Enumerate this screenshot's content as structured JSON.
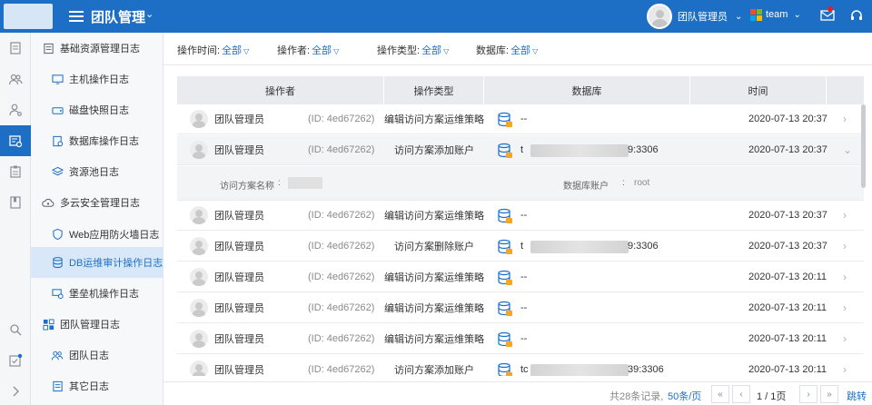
{
  "header": {
    "app_title": "团队管理",
    "user_name": "团队管理员",
    "team_name": "team"
  },
  "colors": {
    "primary": "#1d6fc6",
    "active_nav_bg": "#d8e8f8"
  },
  "sidebar": {
    "groups": [
      {
        "label": "基础资源管理日志",
        "icon": "resource-icon",
        "items": [
          {
            "label": "主机操作日志",
            "icon": "monitor-icon"
          },
          {
            "label": "磁盘快照日志",
            "icon": "disk-icon"
          },
          {
            "label": "数据库操作日志",
            "icon": "db-log-icon"
          },
          {
            "label": "资源池日志",
            "icon": "layers-icon"
          }
        ]
      },
      {
        "label": "多云安全管理日志",
        "icon": "cloud-eye-icon",
        "items": [
          {
            "label": "Web应用防火墙日志",
            "icon": "shield-icon"
          },
          {
            "label": "DB运维审计操作日志",
            "icon": "database-icon",
            "active": true
          },
          {
            "label": "堡垒机操作日志",
            "icon": "bastion-icon"
          }
        ]
      },
      {
        "label": "团队管理日志",
        "icon": "grid-icon",
        "items": [
          {
            "label": "团队日志",
            "icon": "team-icon"
          },
          {
            "label": "其它日志",
            "icon": "doc-icon"
          }
        ]
      }
    ]
  },
  "filters": [
    {
      "label": "操作时间:",
      "value": "全部"
    },
    {
      "label": "操作者:",
      "value": "全部"
    },
    {
      "label": "操作类型:",
      "value": "全部"
    },
    {
      "label": "数据库:",
      "value": "全部"
    }
  ],
  "table": {
    "columns": [
      "操作者",
      "操作类型",
      "数据库",
      "时间"
    ],
    "rows": [
      {
        "operator": "团队管理员",
        "id": "(ID:  4ed67262)",
        "type": "编辑访问方案运维策略",
        "db": "--",
        "time": "2020-07-13 20:37"
      },
      {
        "operator": "团队管理员",
        "id": "(ID:  4ed67262)",
        "type": "访问方案添加账户",
        "db_prefix": "t",
        "db": "9:3306",
        "time": "2020-07-13 20:37",
        "expanded": true
      },
      {
        "operator": "团队管理员",
        "id": "(ID:  4ed67262)",
        "type": "编辑访问方案运维策略",
        "db": "--",
        "time": "2020-07-13 20:37"
      },
      {
        "operator": "团队管理员",
        "id": "(ID:  4ed67262)",
        "type": "访问方案删除账户",
        "db_prefix": "t",
        "db": "9:3306",
        "time": "2020-07-13 20:37"
      },
      {
        "operator": "团队管理员",
        "id": "(ID:  4ed67262)",
        "type": "编辑访问方案运维策略",
        "db": "--",
        "time": "2020-07-13 20:11"
      },
      {
        "operator": "团队管理员",
        "id": "(ID:  4ed67262)",
        "type": "编辑访问方案运维策略",
        "db": "--",
        "time": "2020-07-13 20:11"
      },
      {
        "operator": "团队管理员",
        "id": "(ID:  4ed67262)",
        "type": "编辑访问方案运维策略",
        "db": "--",
        "time": "2020-07-13 20:11"
      },
      {
        "operator": "团队管理员",
        "id": "(ID:  4ed67262)",
        "type": "访问方案添加账户",
        "db_prefix": "tc",
        "db": "39:3306",
        "time": "2020-07-13 20:11"
      }
    ],
    "detail": {
      "key1": "访问方案名称",
      "colon1": ":",
      "key2": "数据库账户",
      "colon2": ":",
      "value2": "root"
    }
  },
  "pager": {
    "total": "共28条记录,",
    "page_size": "50条/页",
    "page_info": "1 / 1页",
    "jump": "跳转"
  }
}
